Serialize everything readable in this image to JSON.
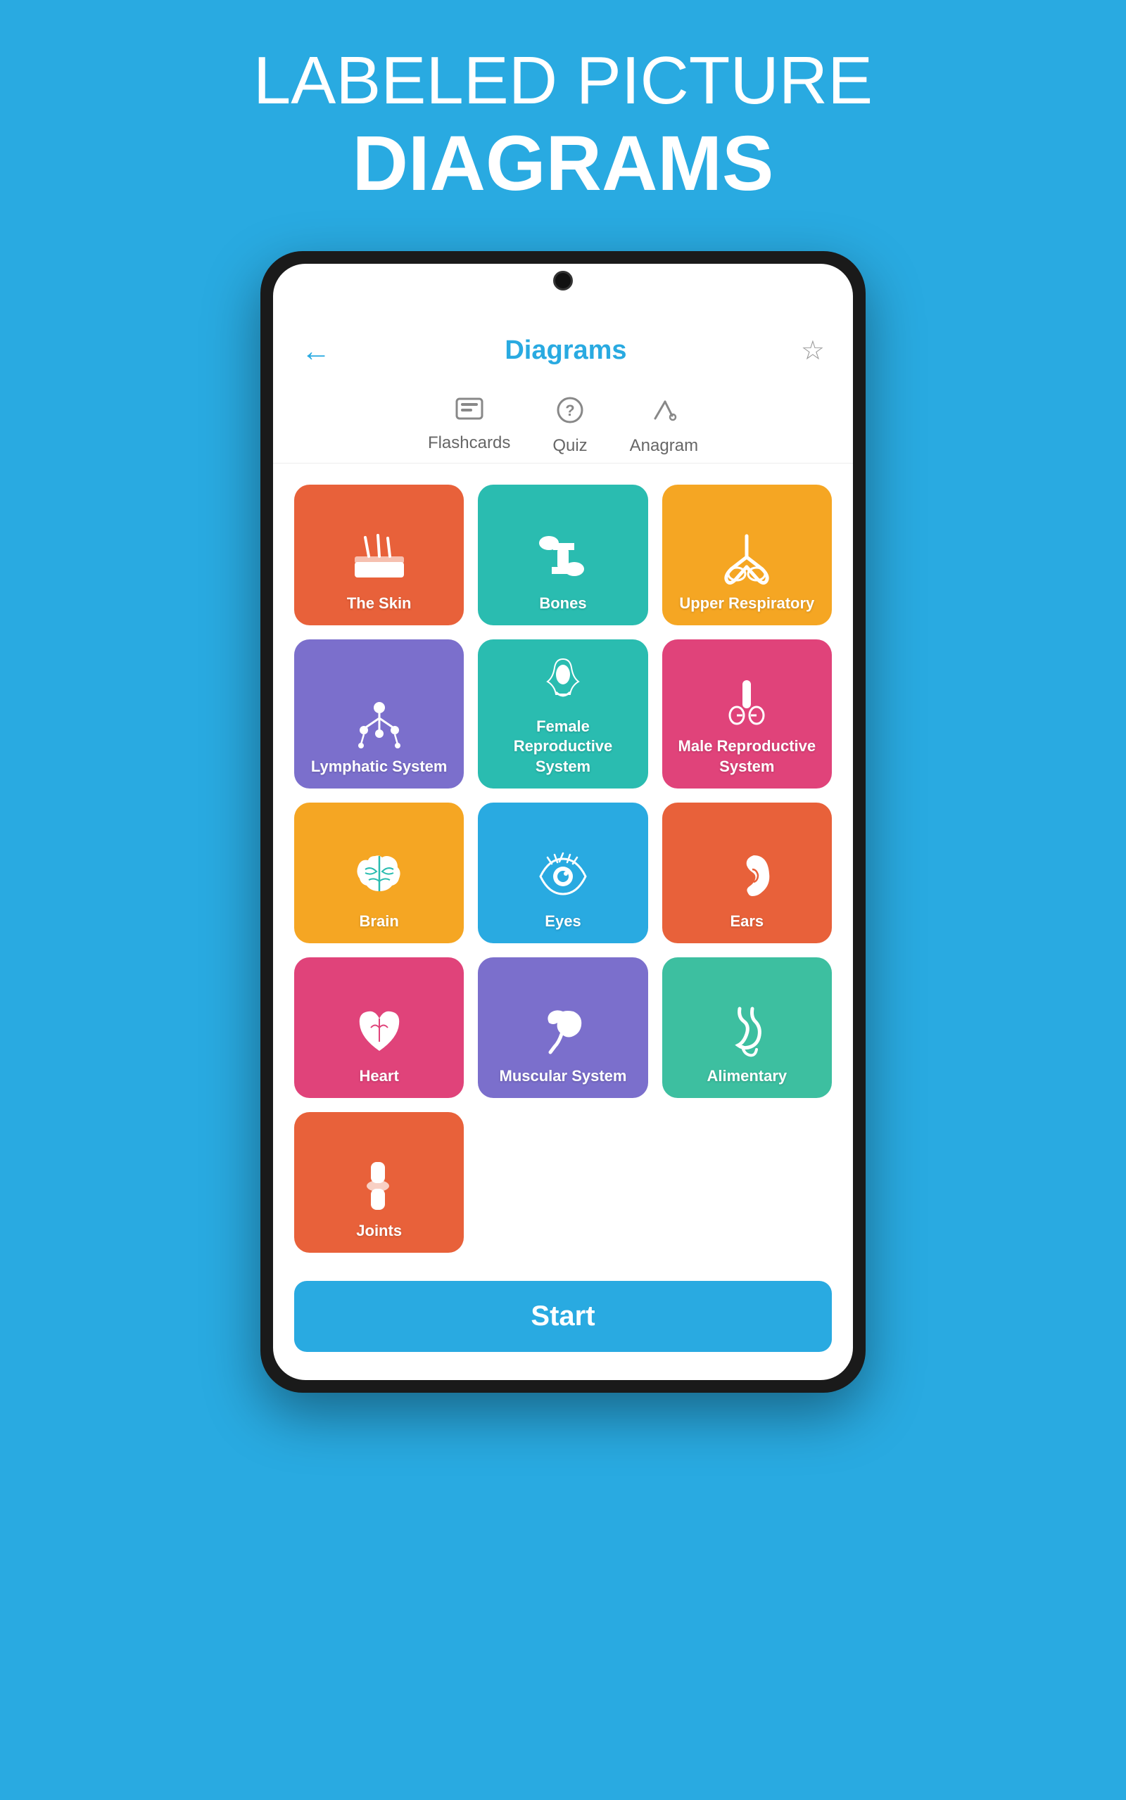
{
  "hero": {
    "line1": "LABELED PICTURE",
    "line2": "DIAGRAMS"
  },
  "header": {
    "title": "Diagrams",
    "back_label": "←",
    "star_label": "☆"
  },
  "tabs": [
    {
      "id": "flashcards",
      "label": "Flashcards",
      "icon": "flashcard"
    },
    {
      "id": "quiz",
      "label": "Quiz",
      "icon": "quiz"
    },
    {
      "id": "anagram",
      "label": "Anagram",
      "icon": "anagram"
    }
  ],
  "grid_items": [
    {
      "id": "the-skin",
      "label": "The Skin",
      "color": "color-orange",
      "icon": "skin"
    },
    {
      "id": "bones",
      "label": "Bones",
      "color": "color-teal",
      "icon": "bones"
    },
    {
      "id": "upper-respiratory",
      "label": "Upper Respiratory",
      "color": "color-yellow",
      "icon": "lungs"
    },
    {
      "id": "lymphatic-system",
      "label": "Lymphatic System",
      "color": "color-purple",
      "icon": "lymph"
    },
    {
      "id": "female-reproductive",
      "label": "Female Reproductive System",
      "color": "color-teal2",
      "icon": "female"
    },
    {
      "id": "male-reproductive",
      "label": "Male Reproductive System",
      "color": "color-pink",
      "icon": "male"
    },
    {
      "id": "brain",
      "label": "Brain",
      "color": "color-amber",
      "icon": "brain"
    },
    {
      "id": "eyes",
      "label": "Eyes",
      "color": "color-blue",
      "icon": "eye"
    },
    {
      "id": "ears",
      "label": "Ears",
      "color": "color-red",
      "icon": "ear"
    },
    {
      "id": "heart",
      "label": "Heart",
      "color": "color-magenta",
      "icon": "heart"
    },
    {
      "id": "muscular-system",
      "label": "Muscular System",
      "color": "color-violet",
      "icon": "muscle"
    },
    {
      "id": "alimentary",
      "label": "Alimentary",
      "color": "color-mint",
      "icon": "gut"
    },
    {
      "id": "joints",
      "label": "Joints",
      "color": "color-orange2",
      "icon": "joint"
    }
  ],
  "start_button": {
    "label": "Start"
  },
  "colors": {
    "primary": "#29aae1",
    "background": "#29aae1"
  }
}
